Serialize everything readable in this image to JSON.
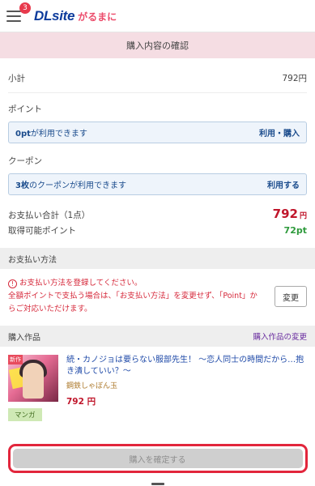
{
  "header": {
    "badge_count": "3",
    "logo_main": "DLsite",
    "logo_sub": "がるまに"
  },
  "page_title": "購入内容の確認",
  "subtotal": {
    "label": "小計",
    "value": "792円"
  },
  "points_section": {
    "label": "ポイント",
    "box_prefix": "0pt",
    "box_text": "が利用できます",
    "action": "利用・購入"
  },
  "coupon_section": {
    "label": "クーポン",
    "box_prefix": "3枚",
    "box_text": "のクーポンが利用できます",
    "action": "利用する"
  },
  "total": {
    "label": "お支払い合計（1点）",
    "price": "792",
    "unit": "円",
    "points_label": "取得可能ポイント",
    "points_value": "72pt"
  },
  "payment": {
    "heading": "お支払い方法",
    "warning_icon": "!",
    "warning_line1": "お支払い方法を登録してください。",
    "warning_line2": "全額ポイントで支払う場合は、「お支払い方法」を変更せず、「Point」からご対応いただけます。",
    "change_label": "変更"
  },
  "products": {
    "heading": "購入作品",
    "change_link": "購入作品の変更",
    "items": [
      {
        "badge": "新作",
        "title": "続・カノジョは要らない服部先生！ ～恋人同士の時間だから…抱き潰していい？～",
        "author": "鋼鉄しゃぼん玉",
        "price": "792 円",
        "genre": "マンガ"
      }
    ]
  },
  "confirm": {
    "label": "購入を確定する"
  },
  "colors": {
    "brand_blue": "#0c3b9c",
    "brand_pink": "#ec4d6c",
    "price_red": "#c0162b",
    "points_green": "#2e9a3c",
    "highlight_outline": "#e2263c"
  }
}
